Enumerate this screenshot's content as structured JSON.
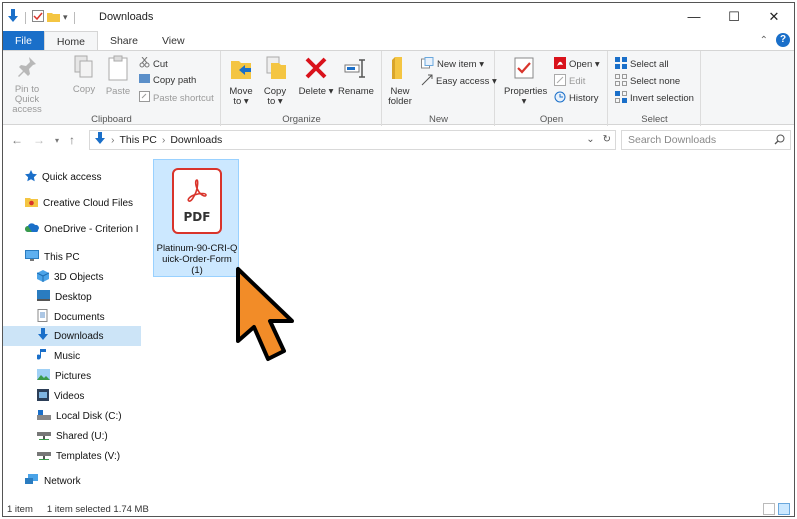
{
  "window": {
    "title": "Downloads",
    "minimize": "—",
    "maximize": "☐",
    "close": "✕"
  },
  "ribbon_tabs": [
    "File",
    "Home",
    "Share",
    "View"
  ],
  "ribbon": {
    "clipboard": {
      "pin_label": "Pin to Quick access",
      "copy_label": "Copy",
      "paste_label": "Paste",
      "cut_label": "Cut",
      "copy_path_label": "Copy path",
      "paste_shortcut_label": "Paste shortcut",
      "group_label": "Clipboard"
    },
    "organize": {
      "move_to_label": "Move to ▾",
      "copy_to_label": "Copy to ▾",
      "delete_label": "Delete ▾",
      "rename_label": "Rename",
      "group_label": "Organize"
    },
    "new": {
      "new_folder_label": "New folder",
      "new_item_label": "New item ▾",
      "easy_access_label": "Easy access ▾",
      "group_label": "New"
    },
    "open": {
      "properties_label": "Properties ▾",
      "open_label": "Open ▾",
      "edit_label": "Edit",
      "history_label": "History",
      "group_label": "Open"
    },
    "select": {
      "select_all_label": "Select all",
      "select_none_label": "Select none",
      "invert_label": "Invert selection",
      "group_label": "Select"
    }
  },
  "address": {
    "crumbs": [
      "This PC",
      "Downloads"
    ],
    "search_placeholder": "Search Downloads"
  },
  "nav_pane": [
    {
      "label": "Quick access",
      "icon": "star-icon"
    },
    {
      "label": "Creative Cloud Files",
      "icon": "creative-cloud-icon"
    },
    {
      "label": "OneDrive - Criterion I",
      "icon": "onedrive-icon"
    },
    {
      "label": "This PC",
      "icon": "computer-icon"
    },
    {
      "label": "3D Objects",
      "icon": "3d-objects-icon"
    },
    {
      "label": "Desktop",
      "icon": "desktop-icon"
    },
    {
      "label": "Documents",
      "icon": "documents-icon"
    },
    {
      "label": "Downloads",
      "icon": "downloads-icon"
    },
    {
      "label": "Music",
      "icon": "music-icon"
    },
    {
      "label": "Pictures",
      "icon": "pictures-icon"
    },
    {
      "label": "Videos",
      "icon": "videos-icon"
    },
    {
      "label": "Local Disk (C:)",
      "icon": "local-disk-icon"
    },
    {
      "label": "Shared (U:)",
      "icon": "network-drive-icon"
    },
    {
      "label": "Templates (V:)",
      "icon": "network-drive-icon"
    },
    {
      "label": "Network",
      "icon": "network-icon"
    }
  ],
  "files": [
    {
      "name": "Platinum-90-CRI-Quick-Order-Form (1)",
      "type_label": "PDF",
      "icon": "pdf-icon"
    }
  ],
  "status": {
    "item_count": "1 item",
    "selection": "1 item selected 1.74 MB"
  },
  "colors": {
    "accent": "#1a6fc9",
    "selection": "#cce8ff",
    "pdf_red": "#d9342b",
    "cursor_orange": "#f28c28"
  }
}
